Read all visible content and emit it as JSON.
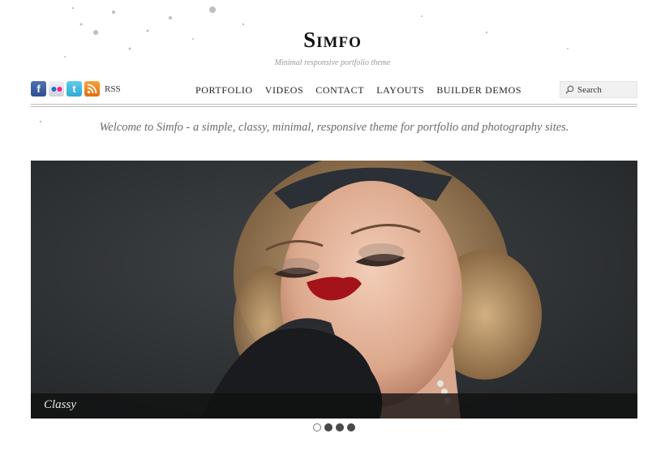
{
  "site": {
    "title": "Simfo",
    "tagline": "Minimal responsive portfolio theme"
  },
  "social": {
    "rss_label": "RSS",
    "icons": [
      "facebook-icon",
      "flickr-icon",
      "twitter-icon",
      "rss-icon"
    ]
  },
  "nav": {
    "items": [
      "PORTFOLIO",
      "VIDEOS",
      "CONTACT",
      "LAYOUTS",
      "BUILDER DEMOS"
    ]
  },
  "search": {
    "placeholder": "Search"
  },
  "welcome": "Welcome to Simfo - a simple, classy, minimal, responsive theme for portfolio and photography sites.",
  "slider": {
    "caption": "Classy",
    "slide_count": 4,
    "active_index": 0
  },
  "colors": {
    "accent_text": "#222222",
    "muted_text": "#6b6b6b",
    "caption_bg": "#0f0f0f",
    "facebook": "#3b5998",
    "twitter": "#3fb8e3",
    "rss": "#f08a24"
  }
}
